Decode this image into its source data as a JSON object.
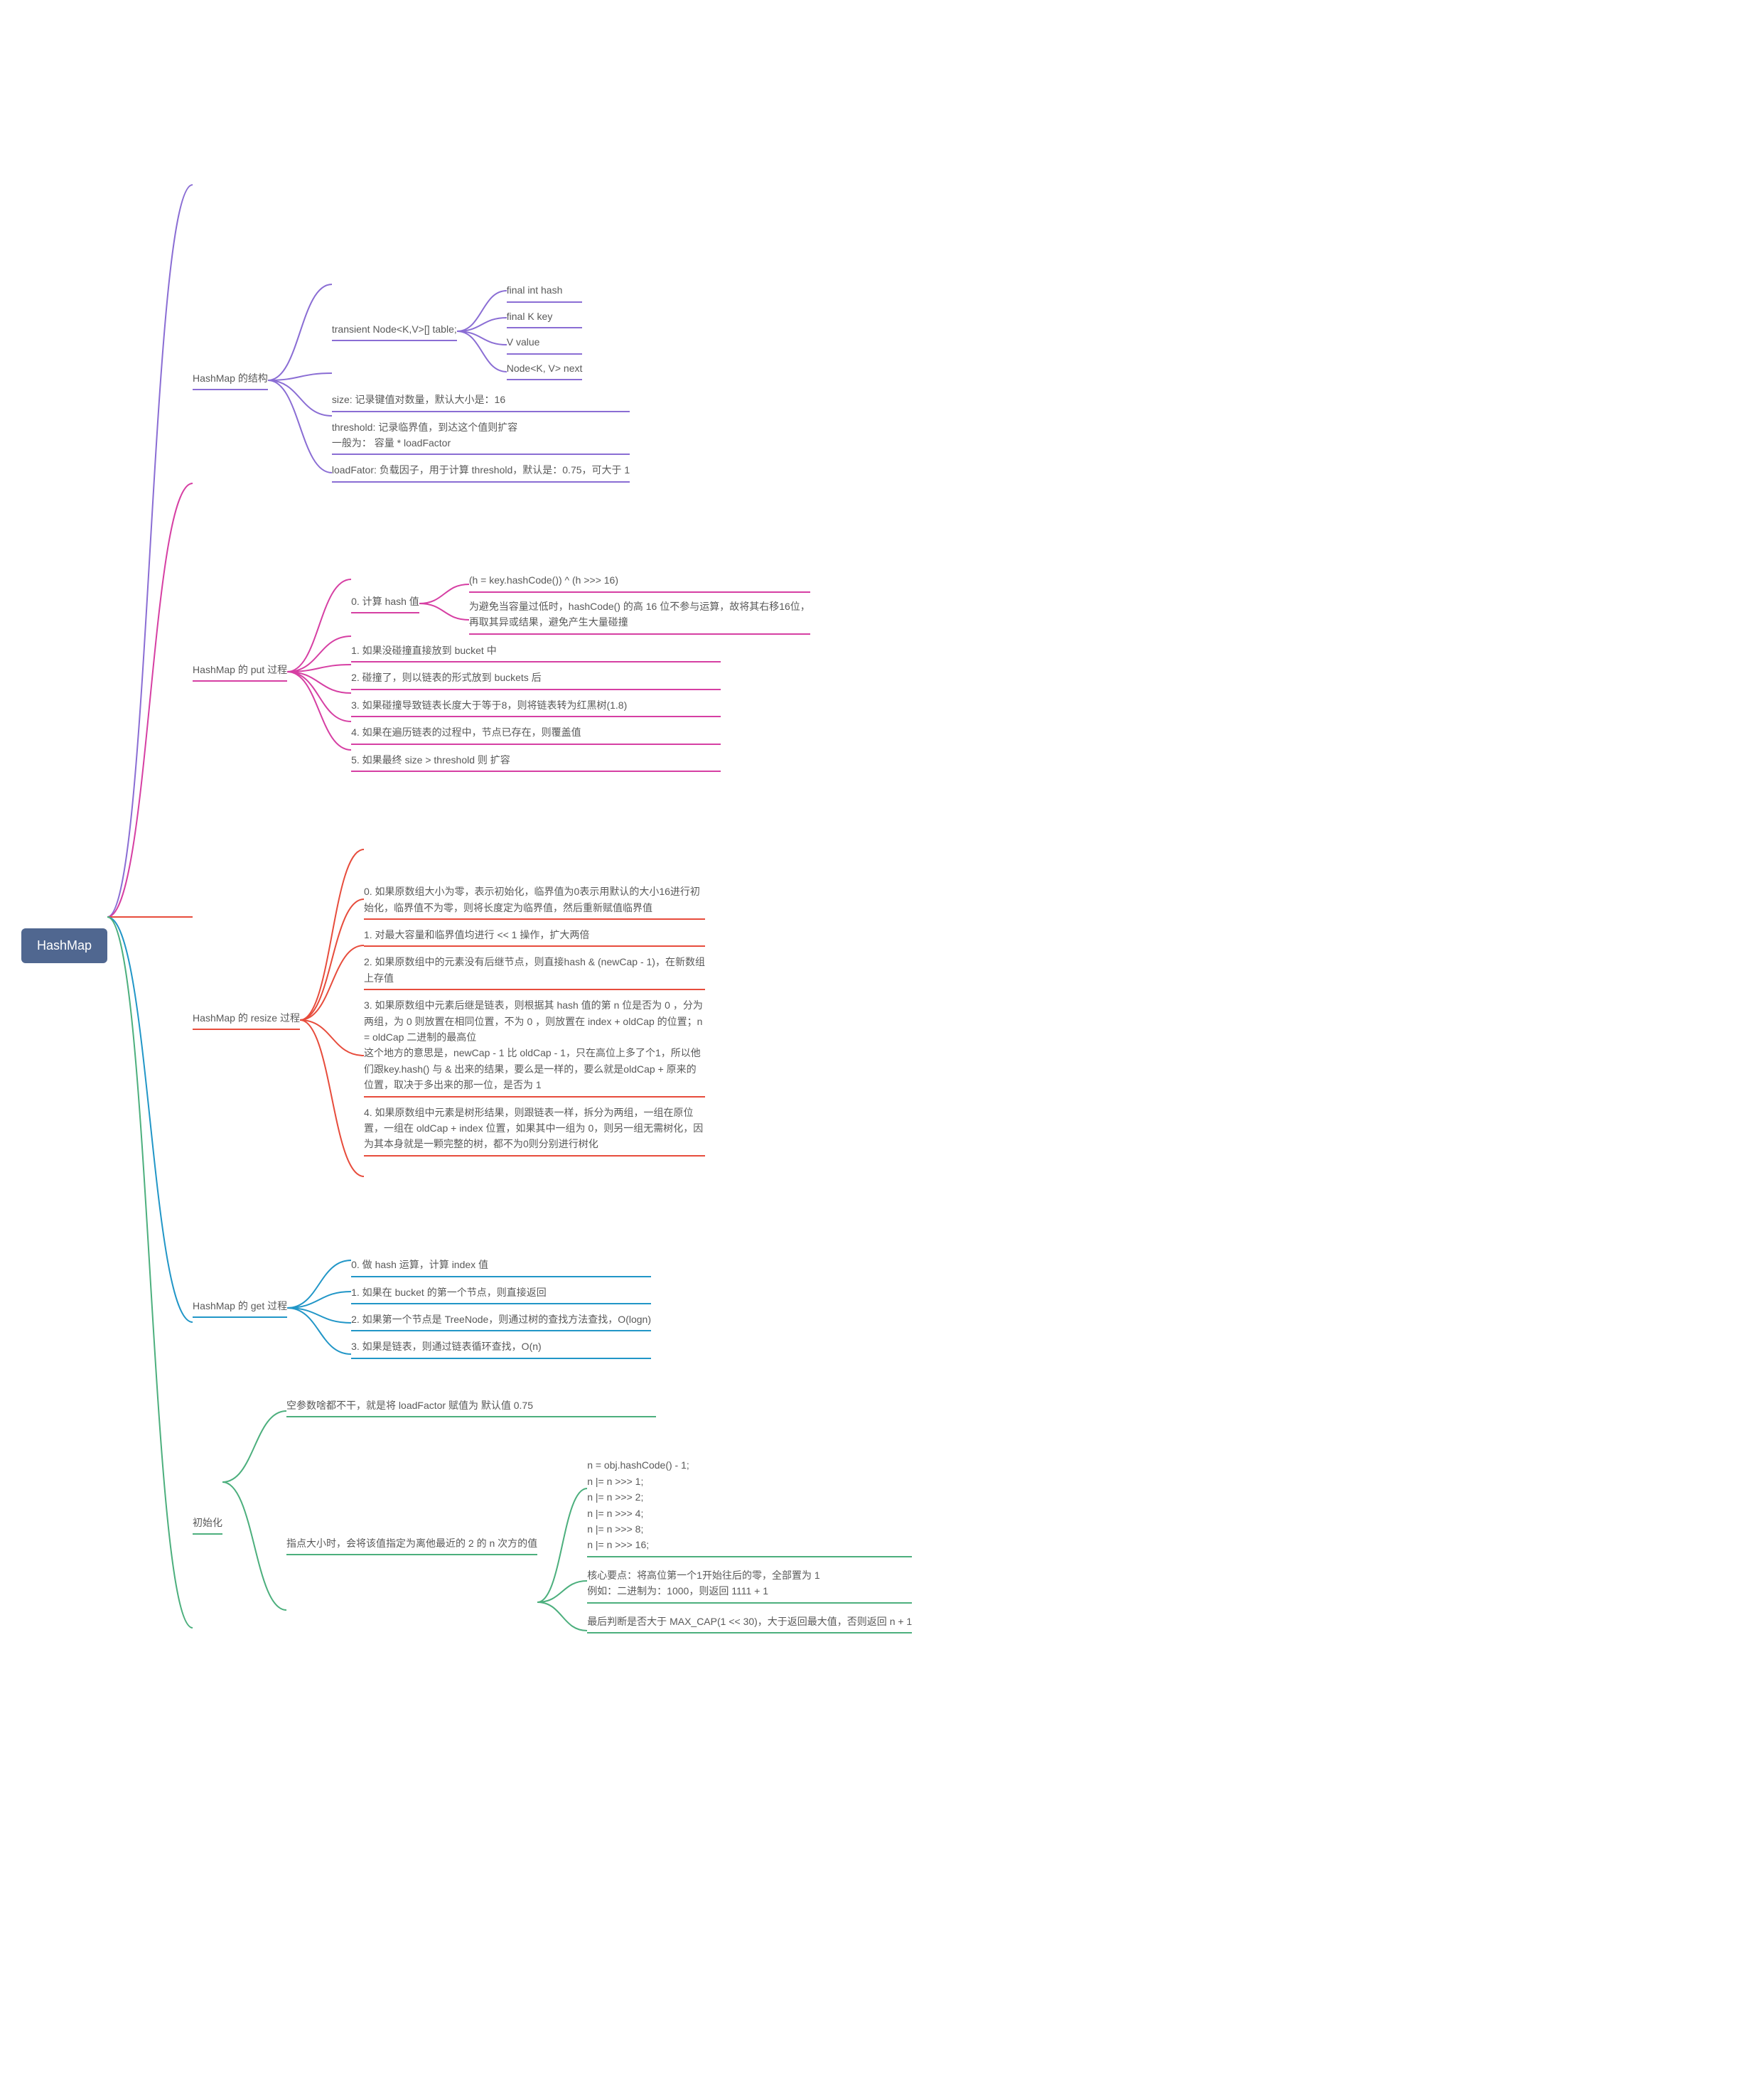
{
  "root": "HashMap",
  "sections": {
    "structure": {
      "title": "HashMap 的结构",
      "color": "#8a6dd4",
      "children": [
        {
          "label": "transient Node<K,V>[] table;",
          "children": [
            {
              "label": "final int hash"
            },
            {
              "label": "final K key"
            },
            {
              "label": "V value"
            },
            {
              "label": "Node<K, V> next"
            }
          ]
        },
        {
          "label": "size: 记录键值对数量，默认大小是：16"
        },
        {
          "label": "threshold: 记录临界值，到达这个值则扩容\n一般为： 容量 * loadFactor"
        },
        {
          "label": "loadFator: 负载因子，用于计算 threshold，默认是：0.75，可大于 1"
        }
      ]
    },
    "put": {
      "title": "HashMap 的 put 过程",
      "color": "#d63fa3",
      "children": [
        {
          "label": "0. 计算 hash 值",
          "children": [
            {
              "label": "(h = key.hashCode()) ^ (h >>> 16)"
            },
            {
              "label": "为避免当容量过低时，hashCode() 的高 16 位不参与运算，故将其右移16位，再取其异或结果，避免产生大量碰撞"
            }
          ]
        },
        {
          "label": "1. 如果没碰撞直接放到 bucket 中"
        },
        {
          "label": "2. 碰撞了，则以链表的形式放到 buckets 后"
        },
        {
          "label": "3. 如果碰撞导致链表长度大于等于8，则将链表转为红黑树(1.8)"
        },
        {
          "label": "4. 如果在遍历链表的过程中，节点已存在，则覆盖值"
        },
        {
          "label": "5. 如果最终 size > threshold 则 扩容"
        }
      ]
    },
    "resize": {
      "title": "HashMap 的 resize 过程",
      "color": "#e74c3c",
      "children": [
        {
          "label": "0. 如果原数组大小为零，表示初始化，临界值为0表示用默认的大小16进行初始化，临界值不为零，则将长度定为临界值，然后重新赋值临界值"
        },
        {
          "label": "1. 对最大容量和临界值均进行 << 1 操作，扩大两倍"
        },
        {
          "label": "2. 如果原数组中的元素没有后继节点，则直接hash & (newCap - 1)，在新数组上存值"
        },
        {
          "label": "3. 如果原数组中元素后继是链表，则根据其 hash 值的第 n 位是否为 0 ，分为两组，为 0 则放置在相同位置，不为 0 ，则放置在 index + oldCap 的位置；n = oldCap 二进制的最高位\n这个地方的意思是，newCap - 1 比 oldCap - 1，只在高位上多了个1，所以他们跟key.hash() 与 & 出来的结果，要么是一样的，要么就是oldCap + 原来的位置，取决于多出来的那一位，是否为 1"
        },
        {
          "label": "4. 如果原数组中元素是树形结果，则跟链表一样，拆分为两组，一组在原位置，一组在 oldCap + index 位置，如果其中一组为 0，则另一组无需树化，因为其本身就是一颗完整的树，都不为0则分别进行树化"
        }
      ]
    },
    "get": {
      "title": "HashMap 的 get 过程",
      "color": "#2196c7",
      "children": [
        {
          "label": "0. 做 hash 运算，计算 index 值"
        },
        {
          "label": "1. 如果在 bucket 的第一个节点，则直接返回"
        },
        {
          "label": "2. 如果第一个节点是 TreeNode，则通过树的查找方法查找，O(logn)"
        },
        {
          "label": "3. 如果是链表，则通过链表循环查找，O(n)"
        }
      ]
    },
    "init": {
      "title": "初始化",
      "color": "#4caf7d",
      "children": [
        {
          "label": "空参数啥都不干，就是将 loadFactor 赋值为 默认值 0.75"
        },
        {
          "label": "指点大小时，会将该值指定为离他最近的 2 的 n 次方的值",
          "children": [
            {
              "label": "n = obj.hashCode() - 1;\nn |= n >>> 1;\nn |= n >>> 2;\nn |= n >>> 4;\nn |= n >>> 8;\nn |= n >>> 16;"
            },
            {
              "label": "核心要点：将高位第一个1开始往后的零，全部置为 1\n例如：二进制为：1000，则返回 1111 + 1"
            },
            {
              "label": "最后判断是否大于 MAX_CAP(1 << 30)，大于返回最大值，否则返回 n + 1"
            }
          ]
        }
      ]
    }
  }
}
